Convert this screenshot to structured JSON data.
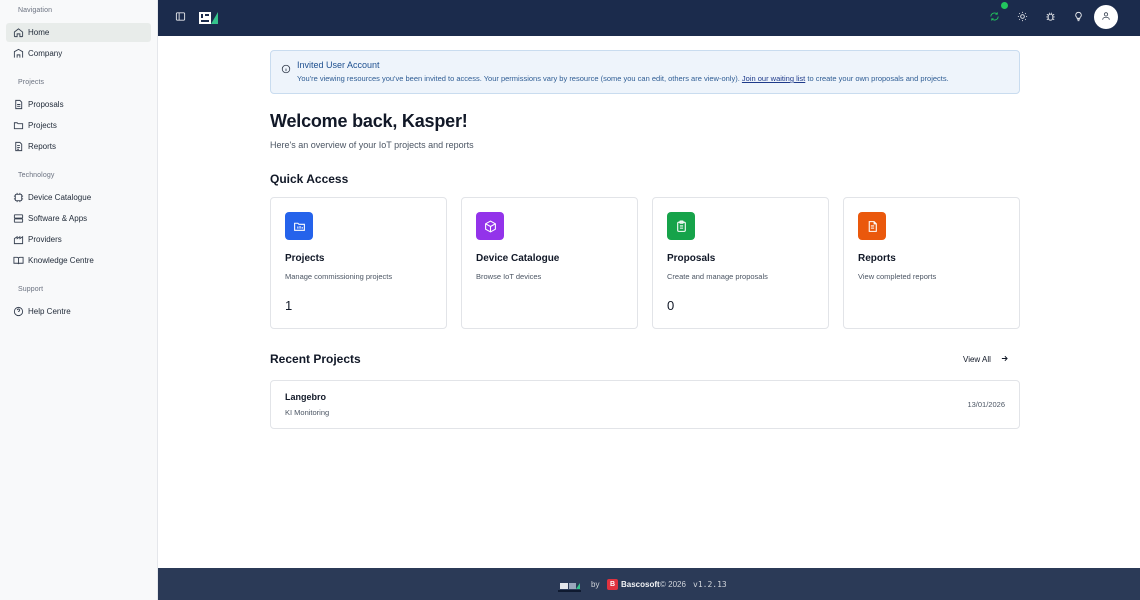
{
  "sidebar": {
    "groups": [
      {
        "heading": "Navigation",
        "items": [
          {
            "label": "Home",
            "icon": "home-icon"
          },
          {
            "label": "Company",
            "icon": "company-icon"
          }
        ]
      },
      {
        "heading": "Projects",
        "items": [
          {
            "label": "Proposals",
            "icon": "document-icon"
          },
          {
            "label": "Projects",
            "icon": "folder-icon"
          },
          {
            "label": "Reports",
            "icon": "report-icon"
          }
        ]
      },
      {
        "heading": "Technology",
        "items": [
          {
            "label": "Device Catalogue",
            "icon": "device-icon"
          },
          {
            "label": "Software & Apps",
            "icon": "server-icon"
          },
          {
            "label": "Providers",
            "icon": "providers-icon"
          },
          {
            "label": "Knowledge Centre",
            "icon": "book-icon"
          }
        ]
      },
      {
        "heading": "Support",
        "items": [
          {
            "label": "Help Centre",
            "icon": "help-icon"
          }
        ]
      }
    ]
  },
  "header": {
    "icons": [
      "sidebar-toggle-icon",
      "app-logo",
      "sync-icon",
      "sun-icon",
      "bug-icon",
      "lightbulb-icon",
      "user-icon"
    ]
  },
  "alert": {
    "title": "Invited User Account",
    "body_before": "You're viewing resources you've been invited to access. Your permissions vary by resource (some you can edit, others are view-only).",
    "link": "Join our waiting list",
    "body_after": "to create your own proposals and projects."
  },
  "welcome": {
    "title": "Welcome back, Kasper!",
    "subtitle": "Here's an overview of your IoT projects and reports"
  },
  "quick_access": {
    "title": "Quick Access",
    "cards": [
      {
        "title": "Projects",
        "desc": "Manage commissioning projects",
        "count": "1",
        "color": "#2563eb",
        "icon": "folder-icon"
      },
      {
        "title": "Device Catalogue",
        "desc": "Browse IoT devices",
        "count": "",
        "color": "#9333ea",
        "icon": "cube-icon"
      },
      {
        "title": "Proposals",
        "desc": "Create and manage proposals",
        "count": "0",
        "color": "#16a34a",
        "icon": "clipboard-icon"
      },
      {
        "title": "Reports",
        "desc": "View completed reports",
        "count": "",
        "color": "#ea580c",
        "icon": "report-icon"
      }
    ]
  },
  "recent_projects": {
    "title": "Recent Projects",
    "view_all": "View All",
    "items": [
      {
        "name": "Langebro",
        "type": "KI Monitoring",
        "date": "13/01/2026"
      }
    ]
  },
  "footer": {
    "by": "by",
    "brand": "Bascosoft",
    "brand_initial": "B",
    "copyright": "© 2026",
    "version": "v1.2.13"
  }
}
